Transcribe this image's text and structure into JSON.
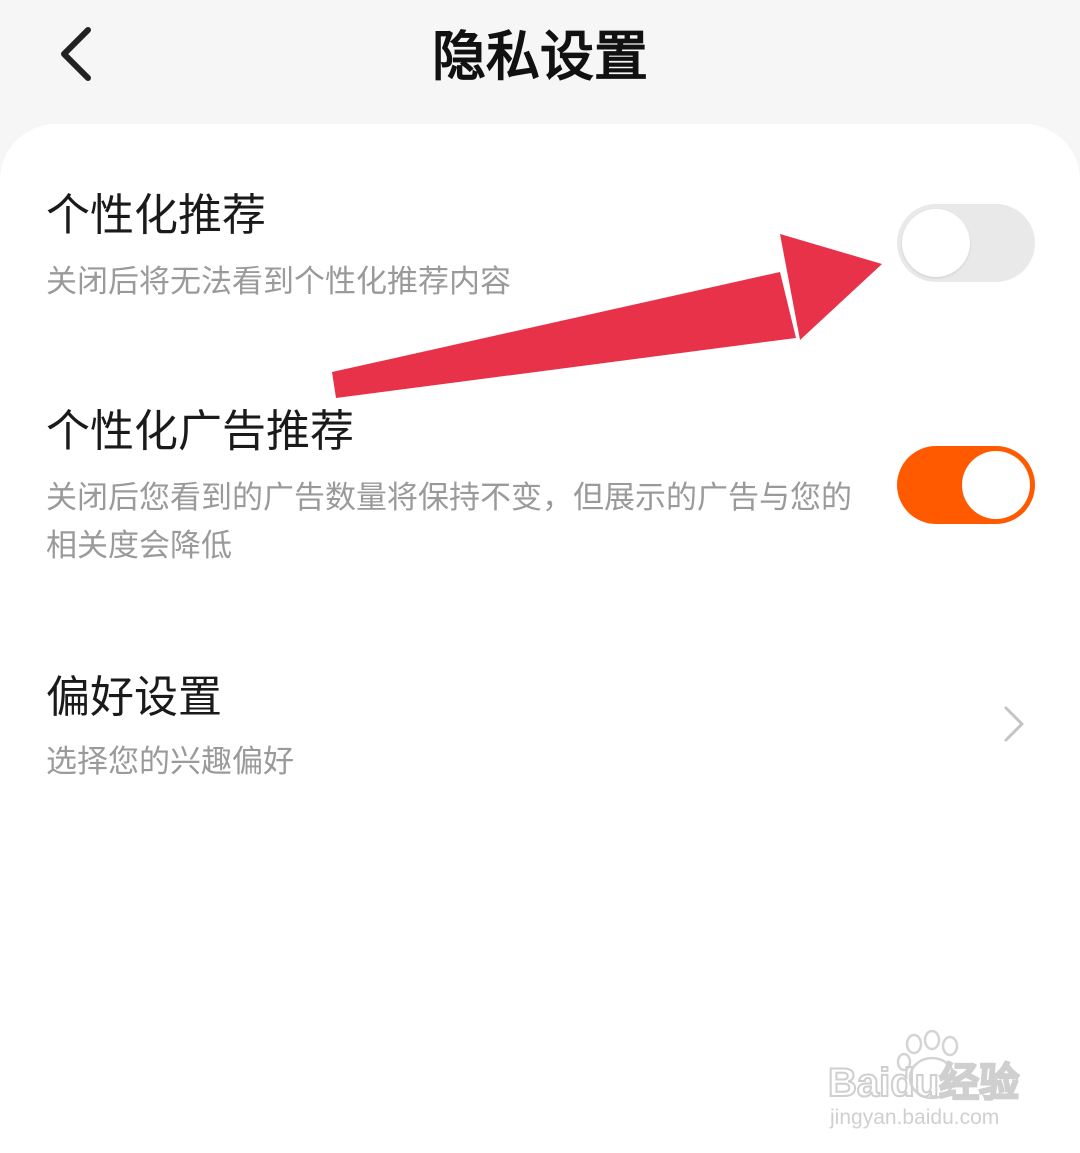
{
  "header": {
    "title": "隐私设置",
    "back_icon": "chevron-left-icon"
  },
  "settings": {
    "personalized_recommendation": {
      "title": "个性化推荐",
      "description": "关闭后将无法看到个性化推荐内容",
      "enabled": false
    },
    "personalized_ads": {
      "title": "个性化广告推荐",
      "description": "关闭后您看到的广告数量将保持不变，但展示的广告与您的相关度会降低",
      "enabled": true
    },
    "preferences": {
      "title": "偏好设置",
      "description": "选择您的兴趣偏好",
      "icon": "chevron-right-icon"
    }
  },
  "watermark": {
    "brand": "Baidu经验",
    "url": "jingyan.baidu.com"
  },
  "colors": {
    "accent_orange": "#ff5a00",
    "toggle_off": "#e9e9e9",
    "annotation_arrow": "#e8324a",
    "header_bg": "#f6f6f6"
  }
}
